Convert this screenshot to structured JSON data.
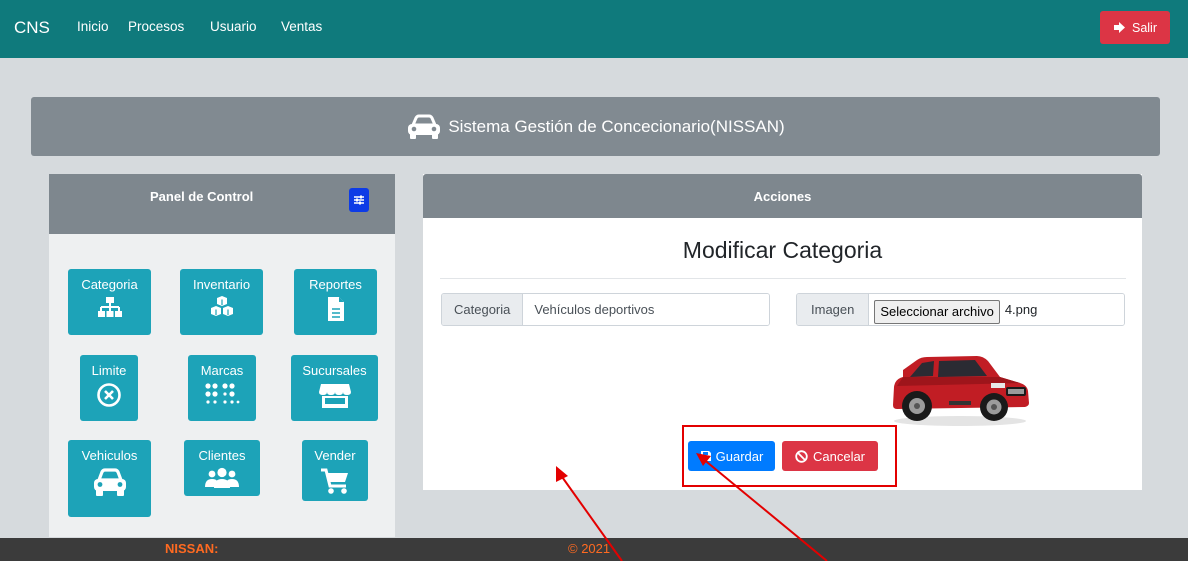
{
  "navbar": {
    "brand": "CNS",
    "links": [
      "Inicio",
      "Procesos",
      "Usuario",
      "Ventas"
    ],
    "logout_label": "Salir"
  },
  "header": {
    "title": "Sistema Gestión de Concecionario(NISSAN)"
  },
  "control_panel": {
    "title": "Panel de Control",
    "tiles": [
      {
        "label": "Categoria",
        "icon": "sitemap-icon"
      },
      {
        "label": "Inventario",
        "icon": "cubes-icon"
      },
      {
        "label": "Reportes",
        "icon": "file-icon"
      },
      {
        "label": "Limite",
        "icon": "times-circle-icon"
      },
      {
        "label": "Marcas",
        "icon": "braille-icon"
      },
      {
        "label": "Sucursales",
        "icon": "store-icon"
      },
      {
        "label": "Vehiculos",
        "icon": "car-icon"
      },
      {
        "label": "Clientes",
        "icon": "users-icon"
      },
      {
        "label": "Vender",
        "icon": "cart-icon"
      }
    ]
  },
  "actions": {
    "header": "Acciones",
    "form_title": "Modificar Categoria",
    "category_label": "Categoria",
    "category_value": "Vehículos deportivos",
    "image_label": "Imagen",
    "file_button": "Seleccionar archivo",
    "file_name": "4.png",
    "save_label": "Guardar",
    "cancel_label": "Cancelar"
  },
  "footer": {
    "brand": "NISSAN:",
    "copyright": "© 2021"
  },
  "colors": {
    "navbar": "#0f7a7c",
    "tile": "#1da3b8",
    "danger": "#dc3545",
    "primary": "#007bff",
    "annotation": "#e30000"
  }
}
